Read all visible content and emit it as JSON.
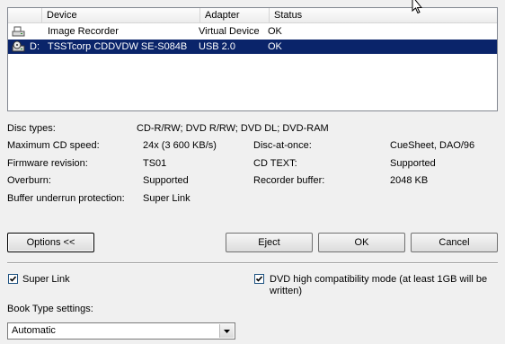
{
  "device_list": {
    "columns": [
      "",
      "Device",
      "Adapter",
      "Status"
    ],
    "rows": [
      {
        "drive": "",
        "device": "Image Recorder",
        "adapter": "Virtual Device",
        "status": "OK",
        "icon": "image-recorder-icon",
        "selected": false
      },
      {
        "drive": "D:",
        "device": "TSSTcorp CDDVDW SE-S084B",
        "adapter": "USB 2.0",
        "status": "OK",
        "icon": "disc-drive-icon",
        "selected": true
      }
    ]
  },
  "info": {
    "disc_types_label": "Disc types:",
    "disc_types_value": "CD-R/RW; DVD R/RW; DVD DL; DVD-RAM",
    "max_speed_label": "Maximum CD speed:",
    "max_speed_value": "24x (3 600 KB/s)",
    "disc_at_once_label": "Disc-at-once:",
    "disc_at_once_value": "CueSheet, DAO/96",
    "firmware_label": "Firmware revision:",
    "firmware_value": "TS01",
    "cd_text_label": "CD TEXT:",
    "cd_text_value": "Supported",
    "overburn_label": "Overburn:",
    "overburn_value": "Supported",
    "buffer_label": "Recorder buffer:",
    "buffer_value": "2048 KB",
    "underrun_label": "Buffer underrun protection:",
    "underrun_value": "Super Link"
  },
  "buttons": {
    "options": "Options <<",
    "eject": "Eject",
    "ok": "OK",
    "cancel": "Cancel"
  },
  "options": {
    "super_link_label": "Super Link",
    "super_link_checked": true,
    "dvd_compat_label_line1": "DVD high compatibility mode (at least 1GB will be",
    "dvd_compat_label_line2": "written)",
    "dvd_compat_checked": true,
    "book_type_label": "Book Type settings:",
    "book_type_value": "Automatic"
  },
  "colors": {
    "selection": "#0a246a",
    "background": "#f0f0f0"
  }
}
